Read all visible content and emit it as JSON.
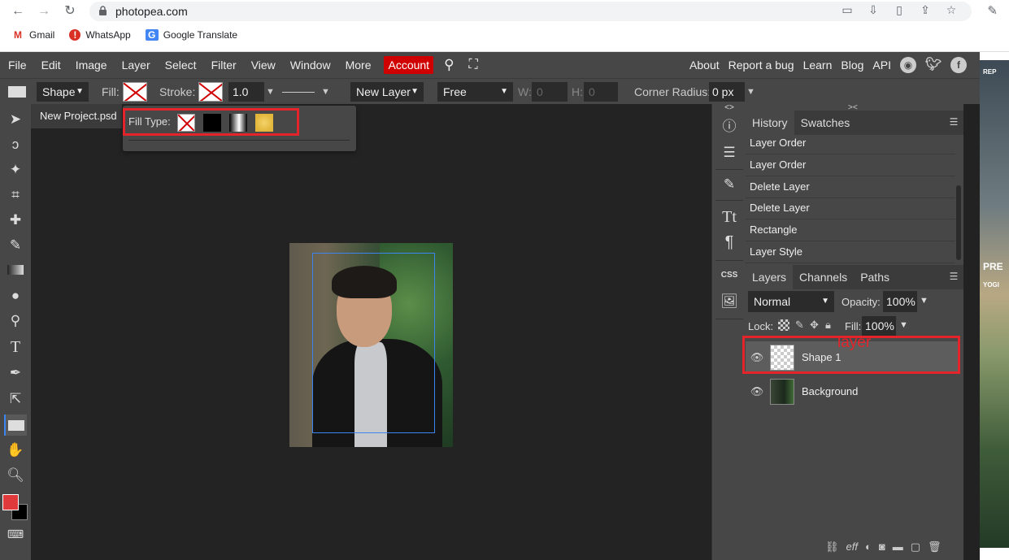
{
  "browser": {
    "url": "photopea.com",
    "bookmarks": [
      {
        "label": "Gmail"
      },
      {
        "label": "WhatsApp"
      },
      {
        "label": "Google Translate"
      }
    ]
  },
  "menu": {
    "items": [
      "File",
      "Edit",
      "Image",
      "Layer",
      "Select",
      "Filter",
      "View",
      "Window",
      "More"
    ],
    "account": "Account",
    "right": [
      "About",
      "Report a bug",
      "Learn",
      "Blog",
      "API"
    ]
  },
  "options": {
    "shape_mode": "Shape",
    "fill_label": "Fill:",
    "stroke_label": "Stroke:",
    "stroke_width": "1.0 px",
    "layer_mode": "New Layer",
    "size_mode": "Free",
    "w_label": "W:",
    "w_value": "0",
    "h_label": "H:",
    "h_value": "0",
    "corner_label": "Corner Radius:",
    "corner_value": "0 px"
  },
  "document": {
    "tab": "New Project.psd"
  },
  "fill_popup": {
    "label": "Fill Type:"
  },
  "history": {
    "tabs": [
      "History",
      "Swatches"
    ],
    "items": [
      "Layer Order",
      "Layer Order",
      "Delete Layer",
      "Delete Layer",
      "Rectangle",
      "Layer Style"
    ]
  },
  "layers": {
    "tabs": [
      "Layers",
      "Channels",
      "Paths"
    ],
    "blend_mode": "Normal",
    "opacity_label": "Opacity:",
    "opacity": "100%",
    "lock_label": "Lock:",
    "fill_label": "Fill:",
    "fill": "100%",
    "rows": [
      {
        "name": "Shape 1",
        "selected": true
      },
      {
        "name": "Background",
        "selected": false
      }
    ],
    "annotation": "layer"
  },
  "colors": {
    "foreground": "#e0393b",
    "background": "#000000",
    "accent": "#3c84f0",
    "highlight": "#e3242b",
    "account": "#d10000"
  },
  "ad": {
    "lines": [
      "REP",
      "PRE",
      "YOGI"
    ]
  }
}
